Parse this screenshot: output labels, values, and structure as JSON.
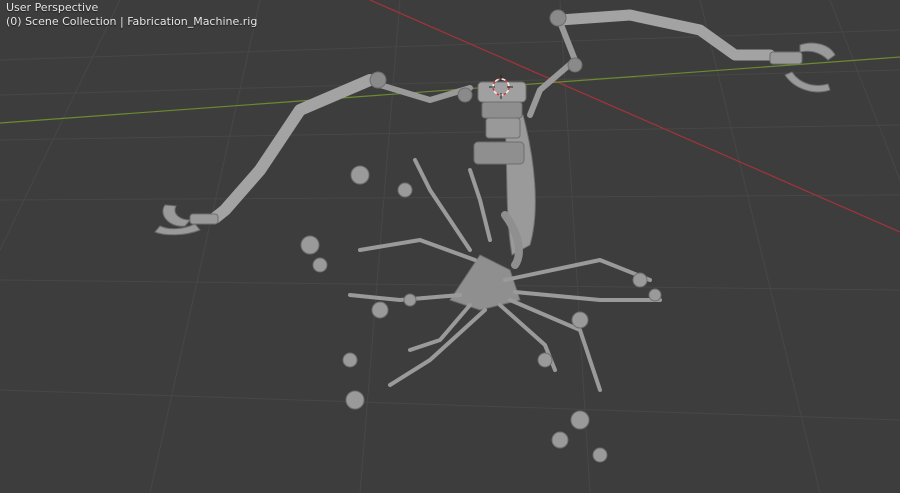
{
  "viewport": {
    "view_label": "User Perspective",
    "collection_label": "(0) Scene Collection | Fabrication_Machine.rig"
  },
  "colors": {
    "background": "#3d3d3d",
    "grid": "#474747",
    "x_axis": "#a3333b",
    "y_axis": "#6c8a2f",
    "mesh": "#9a9a9a",
    "mesh_shadow": "#6e6e6e",
    "cursor_red": "#d13a3a"
  },
  "scene_objects": [
    "Fabrication_Machine.rig"
  ]
}
